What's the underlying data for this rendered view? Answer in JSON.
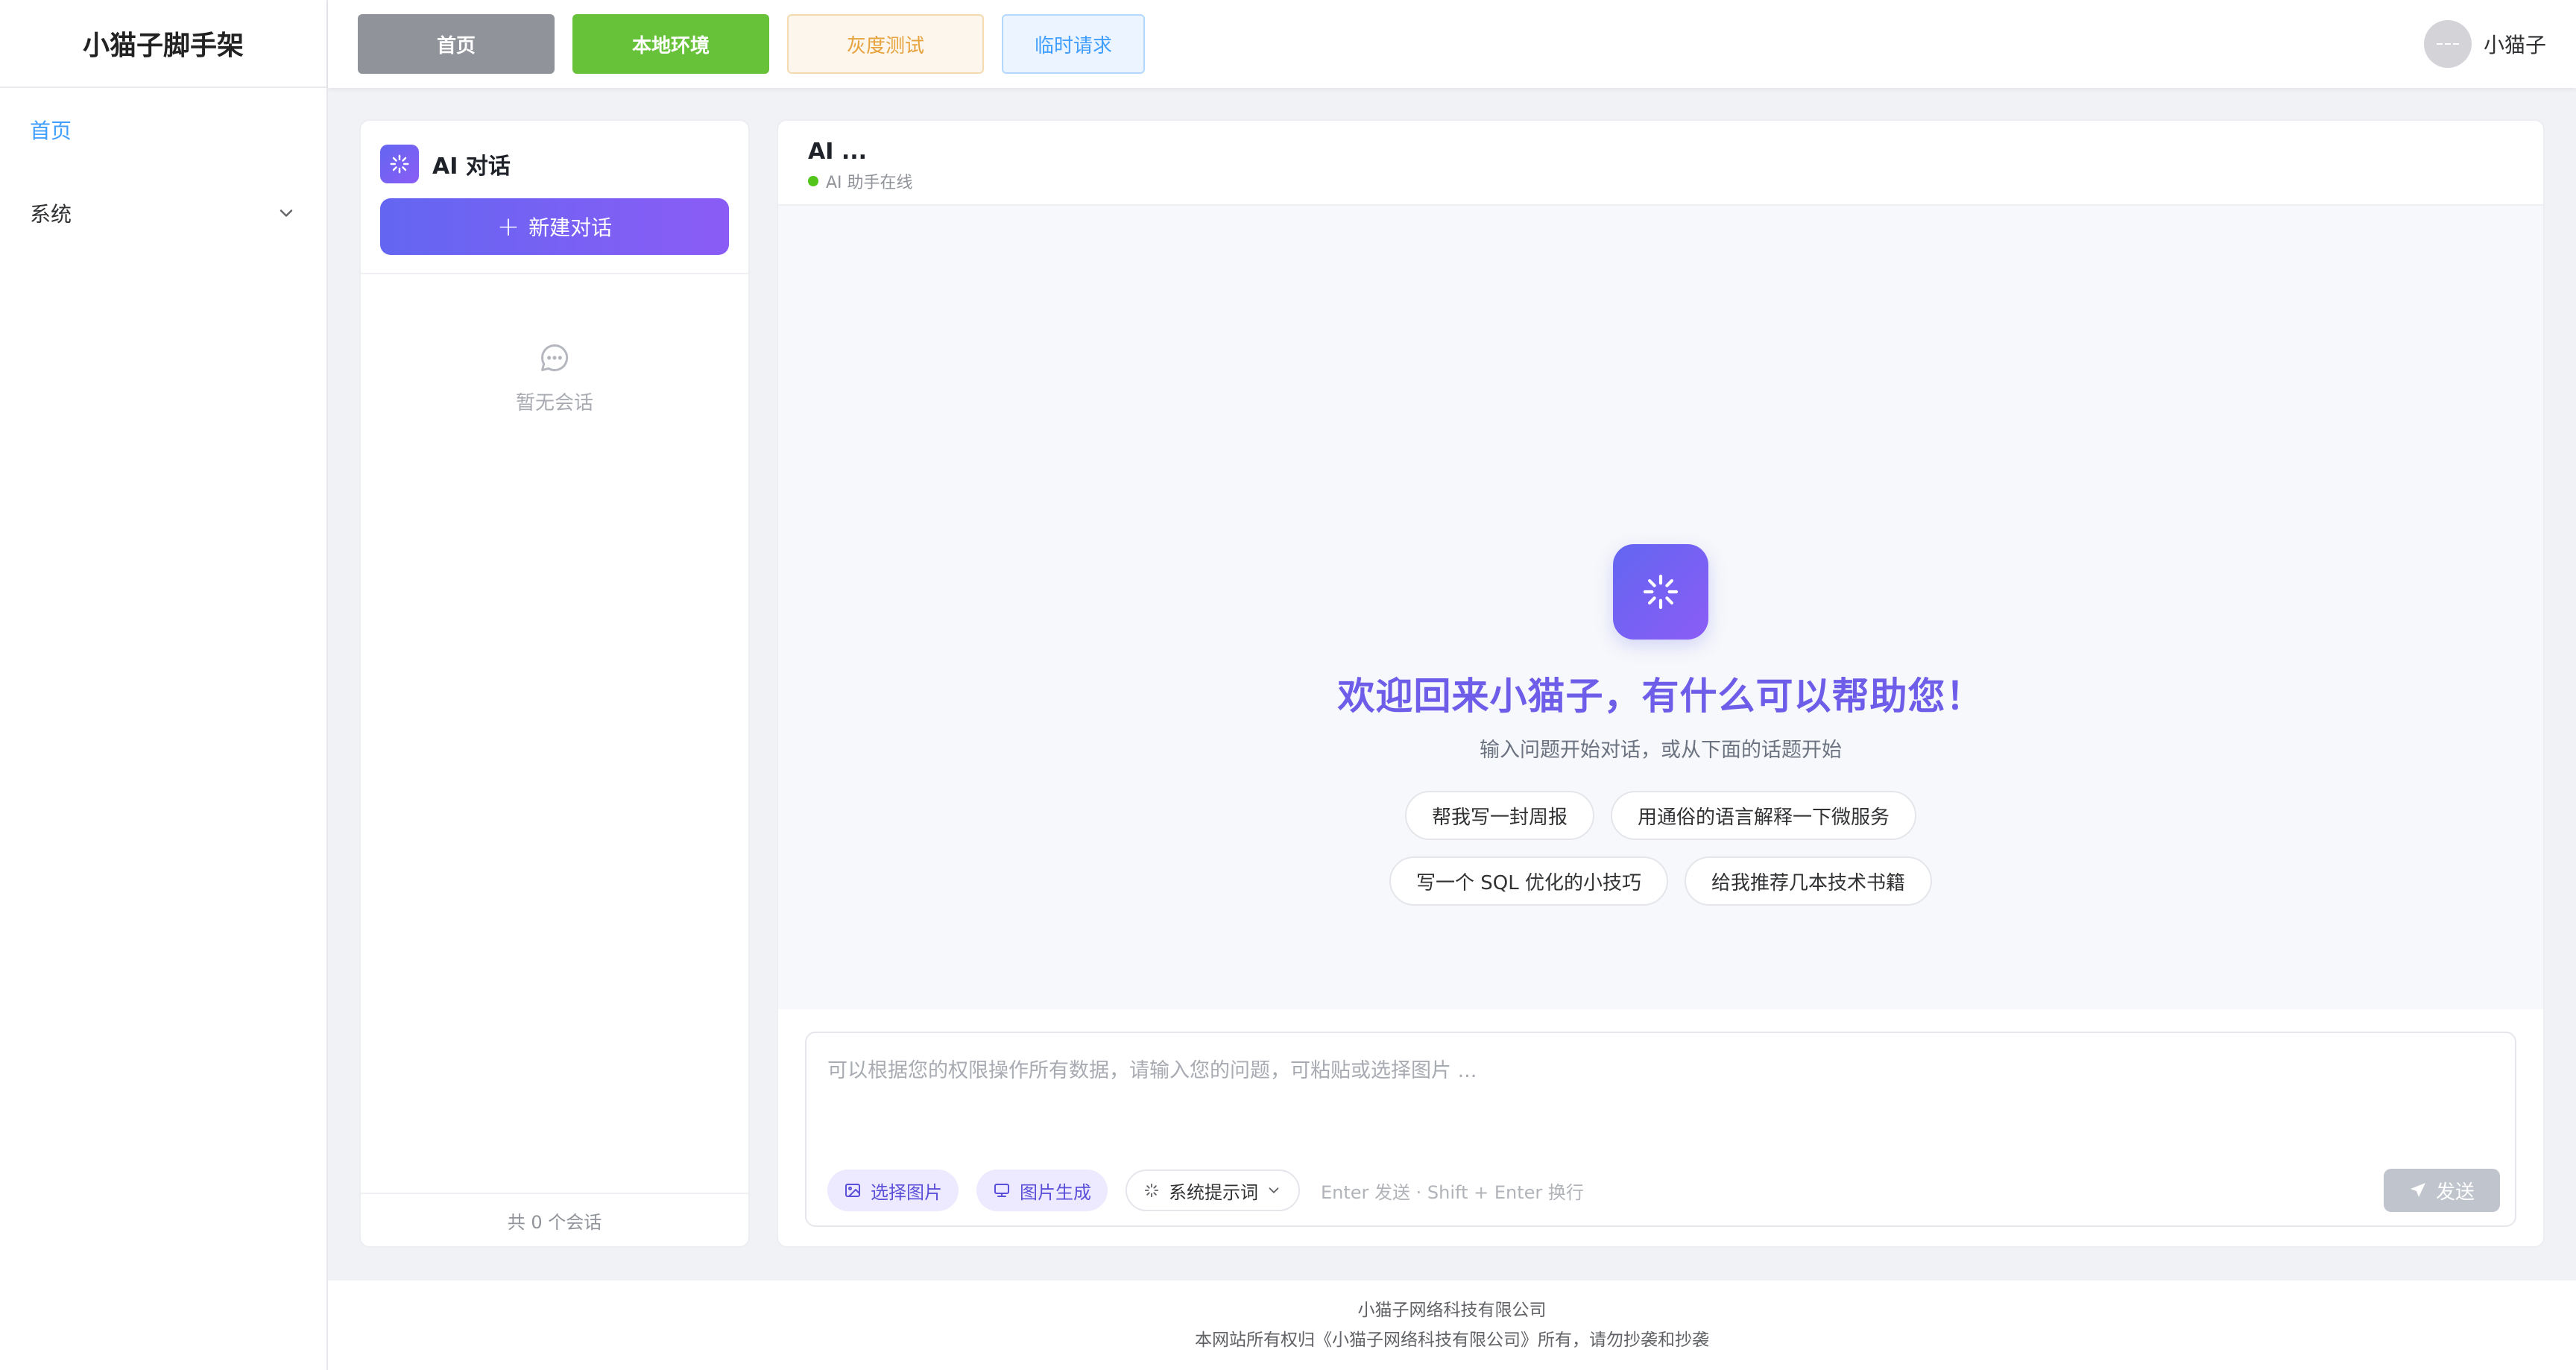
{
  "app": {
    "brand": "小猫子脚手架"
  },
  "sidebar": {
    "items": [
      {
        "label": "首页"
      },
      {
        "label": "系统"
      }
    ]
  },
  "header": {
    "env_buttons": [
      {
        "label": "首页"
      },
      {
        "label": "本地环境"
      },
      {
        "label": "灰度测试"
      },
      {
        "label": "临时请求"
      }
    ],
    "user": {
      "name": "小猫子"
    }
  },
  "conversations": {
    "title": "AI 对话",
    "new_button": "新建对话",
    "empty_text": "暂无会话",
    "footer": "共 0 个会话"
  },
  "chat": {
    "name": "AI ...",
    "status": "AI 助手在线",
    "welcome_title": "欢迎回来小猫子，有什么可以帮助您！",
    "welcome_sub": "输入问题开始对话，或从下面的话题开始",
    "suggestions": [
      "帮我写一封周报",
      "用通俗的语言解释一下微服务",
      "写一个 SQL 优化的小技巧",
      "给我推荐几本技术书籍"
    ],
    "input_placeholder": "可以根据您的权限操作所有数据，请输入您的问题，可粘贴或选择图片 ...",
    "tools": {
      "select_image": "选择图片",
      "generate_image": "图片生成",
      "system_prompt": "系统提示词"
    },
    "hint": "Enter 发送 · Shift + Enter 换行",
    "send": "发送"
  },
  "footer": {
    "company": "小猫子网络科技有限公司",
    "copyright": "本网站所有权归《小猫子网络科技有限公司》所有，请勿抄袭和抄袭"
  },
  "colors": {
    "accent": "#6366f1",
    "accent2": "#8b5cf6",
    "online": "#52c41a",
    "link": "#409eff"
  }
}
